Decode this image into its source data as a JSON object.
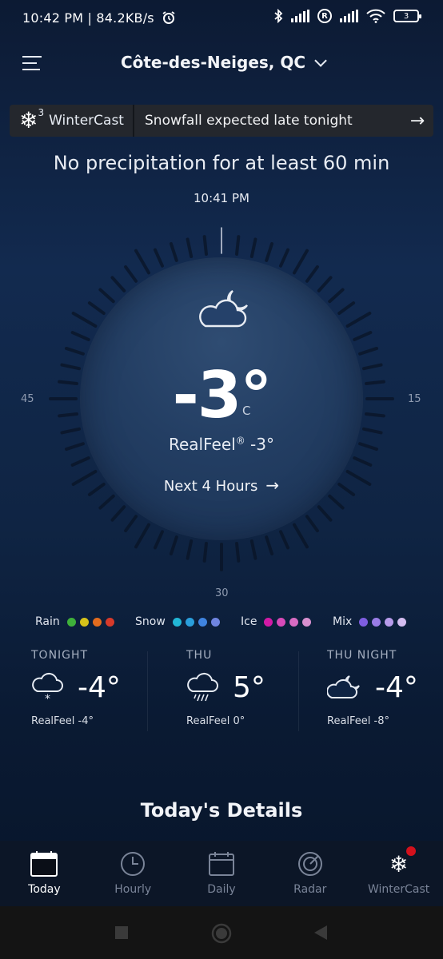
{
  "status_bar": {
    "time": "10:42 PM",
    "speed": "84.2KB/s",
    "battery": "3",
    "icons": [
      "alarm-icon",
      "bluetooth-icon",
      "signal-icon",
      "roaming-icon",
      "signal-icon",
      "wifi-icon",
      "battery-icon"
    ]
  },
  "header": {
    "location": "Côte-des-Neiges, QC"
  },
  "banner": {
    "brand": "WinterCast",
    "brand_superscript": "3",
    "message": "Snowfall expected late tonight"
  },
  "precip_message": "No precipitation for at least 60 min",
  "dial": {
    "time": "10:41 PM",
    "label_left": "45",
    "label_right": "15",
    "label_bottom": "30"
  },
  "current": {
    "temp": "-3°",
    "unit": "C",
    "realfeel_label": "RealFeel",
    "realfeel_mark": "®",
    "realfeel_value": "-3°",
    "next_hours": "Next 4 Hours"
  },
  "legend": [
    {
      "label": "Rain",
      "colors": [
        "#3fb13a",
        "#d6c21a",
        "#e36c1e",
        "#d73a2a"
      ]
    },
    {
      "label": "Snow",
      "colors": [
        "#22b7d6",
        "#2a9fdc",
        "#3f84e0",
        "#6f85e0"
      ]
    },
    {
      "label": "Ice",
      "colors": [
        "#d21aa6",
        "#d84ab8",
        "#d86cc2",
        "#d890cf"
      ]
    },
    {
      "label": "Mix",
      "colors": [
        "#7e5ee0",
        "#9a7de6",
        "#b89ceb",
        "#d4bdf0"
      ]
    }
  ],
  "forecast": [
    {
      "period": "TONIGHT",
      "temp": "-4°",
      "realfeel": "RealFeel -4°",
      "icon": "cloud-snow-icon"
    },
    {
      "period": "THU",
      "temp": "5°",
      "realfeel": "RealFeel 0°",
      "icon": "cloud-rain-icon"
    },
    {
      "period": "THU NIGHT",
      "temp": "-4°",
      "realfeel": "RealFeel -8°",
      "icon": "cloud-moon-icon"
    }
  ],
  "details_heading": "Today's Details",
  "nav": {
    "items": [
      {
        "label": "Today",
        "active": true
      },
      {
        "label": "Hourly",
        "active": false
      },
      {
        "label": "Daily",
        "active": false
      },
      {
        "label": "Radar",
        "active": false
      },
      {
        "label": "WinterCast",
        "active": false
      }
    ]
  }
}
